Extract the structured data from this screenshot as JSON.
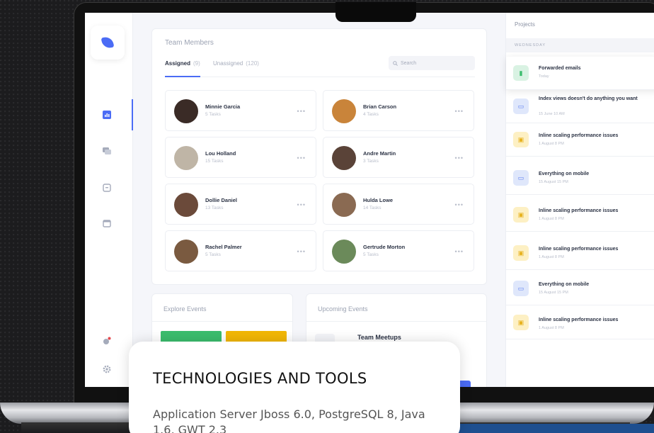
{
  "team": {
    "title": "Team Members",
    "tabs": [
      {
        "label": "Assigned",
        "count": "(9)"
      },
      {
        "label": "Unassigned",
        "count": "(120)"
      }
    ],
    "search_placeholder": "Search",
    "members": [
      {
        "name": "Minnie Garcia",
        "tasks": "5 Tasks",
        "avatar_color": "#3a2b26"
      },
      {
        "name": "Brian Carson",
        "tasks": "4 Tasks",
        "avatar_color": "#c9843a"
      },
      {
        "name": "Lou Holland",
        "tasks": "15 Tasks",
        "avatar_color": "#bfb5a6"
      },
      {
        "name": "Andre Martin",
        "tasks": "3 Tasks",
        "avatar_color": "#5a4338"
      },
      {
        "name": "Dollie Daniel",
        "tasks": "13 Tasks",
        "avatar_color": "#6b4a3a"
      },
      {
        "name": "Hulda Lowe",
        "tasks": "14 Tasks",
        "avatar_color": "#8a6a52"
      },
      {
        "name": "Rachel Palmer",
        "tasks": "5 Tasks",
        "avatar_color": "#7a5a40"
      },
      {
        "name": "Gertrude Morton",
        "tasks": "5 Tasks",
        "avatar_color": "#6b8a5a"
      }
    ]
  },
  "events": {
    "explore_title": "Explore Events",
    "upcoming_title": "Upcoming Events",
    "meetup_title": "Team Meetups",
    "tile_colors": [
      "#3bbd6d",
      "#f2b705"
    ]
  },
  "projects": {
    "title": "Projects",
    "day": "WEDNESDAY",
    "items": [
      {
        "title": "Forwarded emails",
        "time": "Today",
        "icon": "chart-icon",
        "color": "green"
      },
      {
        "title": "Index views doesn't do anything you want",
        "time": "15 June 10 AM",
        "icon": "calendar-icon",
        "color": "blue"
      },
      {
        "title": "Inline scaling performance issues",
        "time": "1 August 8 PM",
        "icon": "briefcase-icon",
        "color": "yellow"
      },
      {
        "title": "Everything on mobile",
        "time": "15 August 15 PM",
        "icon": "calendar-icon",
        "color": "blue"
      },
      {
        "title": "Inline scaling performance issues",
        "time": "1 August 8 PM",
        "icon": "briefcase-icon",
        "color": "yellow"
      },
      {
        "title": "Inline scaling performance issues",
        "time": "1 August 8 PM",
        "icon": "briefcase-icon",
        "color": "yellow"
      },
      {
        "title": "Everything on mobile",
        "time": "15 August 15 PM",
        "icon": "calendar-icon",
        "color": "blue"
      },
      {
        "title": "Inline scaling performance issues",
        "time": "1 August 8 PM",
        "icon": "briefcase-icon",
        "color": "yellow"
      }
    ]
  },
  "overlay": {
    "heading": "TECHNOLOGIES AND TOOLS",
    "body": "Application Server Jboss 6.0, PostgreSQL 8, Java 1.6, GWT 2.3"
  },
  "colors": {
    "accent": "#4b6cf5"
  }
}
